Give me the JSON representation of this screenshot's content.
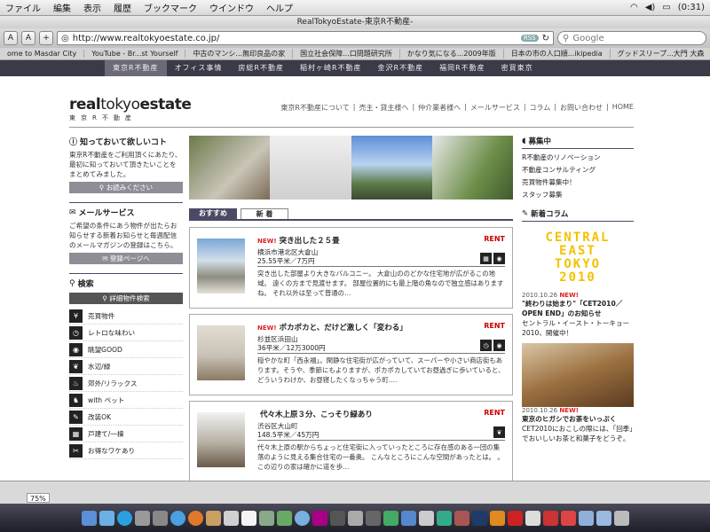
{
  "menubar": {
    "items": [
      "ファイル",
      "編集",
      "表示",
      "履歴",
      "ブックマーク",
      "ウインドウ",
      "ヘルプ"
    ],
    "battery": "(0:31)"
  },
  "window": {
    "title": "RealTokyoEstate-東京R不動産-"
  },
  "toolbar": {
    "font_small": "A",
    "font_large": "A",
    "add": "+",
    "url": "http://www.realtokyoestate.co.jp/",
    "rss": "RSS",
    "search_placeholder": "Google"
  },
  "bookmarks": [
    "ome to Masdar City",
    "YouTube - Br...st Yourself",
    "中古のマンシ...無印良品の家",
    "国立社会保障...口問題研究所",
    "かなり気になる...2009年版",
    "日本の市の人口順...ikipedia",
    "グッドスリープ...大門 大森"
  ],
  "sitenav": [
    "東京R不動産",
    "オフィス事情",
    "房総R不動産",
    "稲村ヶ崎R不動産",
    "金沢R不動産",
    "福岡R不動産",
    "密買東京"
  ],
  "logo": {
    "real": "real",
    "tokyo": "tokyo",
    "estate": "estate",
    "sub": "東京R不動産"
  },
  "toplinks": [
    "東京R不動産について",
    "|",
    "売主・貸主様へ",
    "|",
    "仲介業者様へ",
    "|",
    "メールサービス",
    "|",
    "コラム",
    "|",
    "お問い合わせ",
    "|",
    "HOME"
  ],
  "left": {
    "intro_title": "知っておいて欲しいコト",
    "intro_text": "東京R不動産をご利用頂くにあたり、最初に知っておいて頂きたいことをまとめてみました。",
    "intro_btn": "お読みください",
    "mail_title": "メールサービス",
    "mail_text": "ご希望の条件にあう物件が出たらお知らせする新着お知らせと毎週配信のメールマガジンの登録はこちら。",
    "mail_btn": "登録ページへ",
    "search_title": "検索",
    "search_btn": "詳細物件検索",
    "categories": [
      "売買物件",
      "レトロな味わい",
      "眺望GOOD",
      "水辺/緑",
      "郊外/リラックス",
      "with ペット",
      "改装OK",
      "戸建て/一棟",
      "お得なワケあり"
    ]
  },
  "tabs": {
    "recommend": "おすすめ",
    "new": "新 着"
  },
  "listings": [
    {
      "new": "NEW!",
      "title": "突き出した２５畳",
      "type": "RENT",
      "addr": "横浜市港北区大倉山",
      "price": "25.55平米／7万円",
      "desc": "突き出した部屋より大きなバルコニー。 大倉山ののどかな住宅地が広がるこの地域。 遠くの方まで見渡せます。 部屋位置的にも最上階の角なので独立感はありますね。 それ以外は至って普通の…"
    },
    {
      "new": "NEW!",
      "title": "ポカポカと、だけど激しく「変わる」",
      "type": "RENT",
      "addr": "杉並区浜田山",
      "price": "36平米／12万3000円",
      "desc": "穏やかな町「西永福」。閑静な住宅街が広がっていて、スーパーや小さい商店街もあります。そうや、季節にもよりますが、ポカポカしていてお昼過ぎに歩いていると、どういうわけか、お昼寝したくなっちゃう町…."
    },
    {
      "new": "",
      "title": "代々木上原３分、こっそり緑あり",
      "type": "RENT",
      "addr": "渋谷区大山町",
      "price": "148.5平米／45万円",
      "desc": "代々木上原の駅からちょっと住宅街に入っていったところに存在感のある一団の集落のように見える集合住宅の一番奥。 こんなところにこんな空間があったとは。 。 この辺りの家は確かに道を歩…"
    }
  ],
  "right": {
    "recruit_title": "募集中",
    "recruit_links": [
      "R不動産のリノベーション",
      "不動産コンサルティング",
      "売買物件募集中！",
      "スタッフ募集"
    ],
    "column_title": "新着コラム",
    "ce_logo": [
      "CENTRAL",
      "EAST",
      "TOKYO",
      "2010"
    ],
    "col1_date": "2010.10.26",
    "col1_new": "NEW!",
    "col1_bold": "\"終わりは始まり\"「CET2010／OPEN END」のお知らせ",
    "col1_text": "セントラル・イースト・トーキョー 2010、開催中！",
    "col2_date": "2010.10.26",
    "col2_new": "NEW!",
    "col2_bold": "東京のヒガシでお茶をいっぷく",
    "col2_text": "CET2010におこしの際には、「回季」でおいしいお茶と和菓子をどうぞ。"
  },
  "status": {
    "zoom": "75%"
  }
}
